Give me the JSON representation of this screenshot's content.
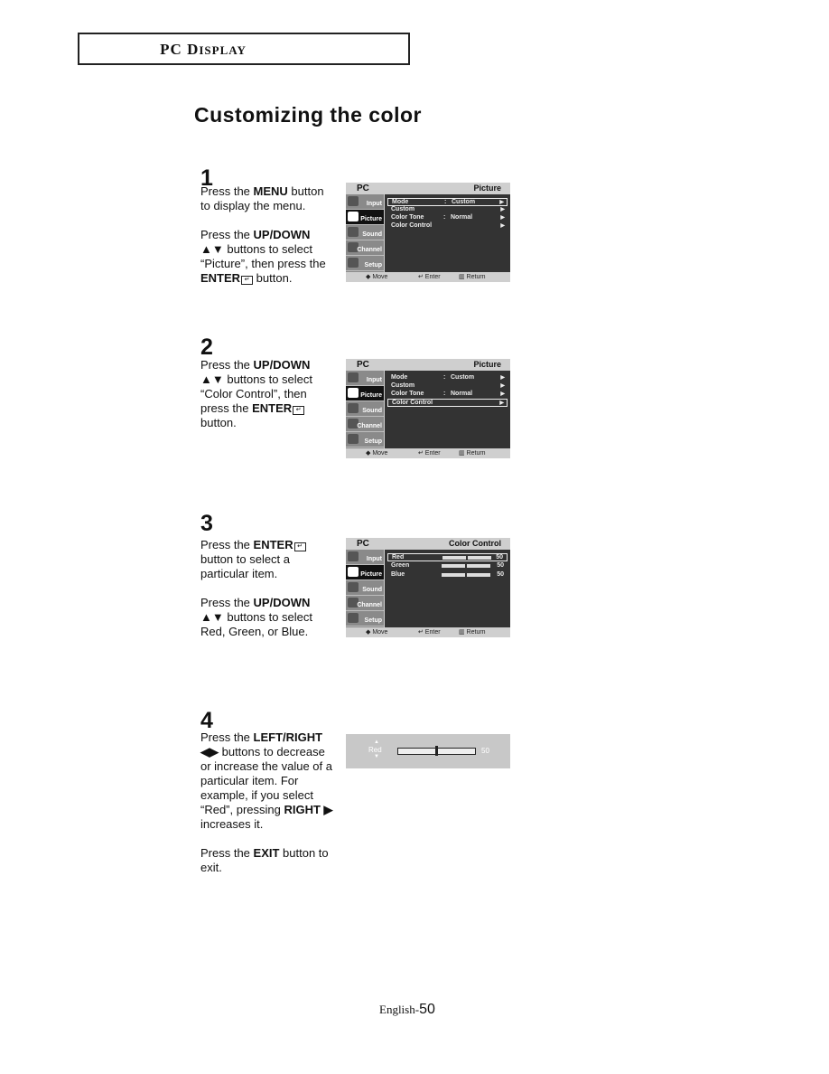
{
  "header": {
    "section_first": "PC D",
    "section_rest": "ISPLAY"
  },
  "title": "Customizing the color",
  "steps": [
    {
      "number": "1",
      "paragraphs": [
        [
          {
            "t": "Press the "
          },
          {
            "b": "MENU"
          },
          {
            "t": " button to display the menu."
          }
        ],
        [
          {
            "t": "Press the "
          },
          {
            "b": "UP/DOWN ▲▼"
          },
          {
            "t": " buttons to select “Picture”, then press the "
          },
          {
            "b": "ENTER"
          },
          {
            "icon": "enter"
          },
          {
            "t": " button."
          }
        ]
      ]
    },
    {
      "number": "2",
      "paragraphs": [
        [
          {
            "t": "Press the "
          },
          {
            "b": "UP/DOWN ▲▼"
          },
          {
            "t": " buttons to select “Color Control”, then press the "
          },
          {
            "b": "ENTER"
          },
          {
            "icon": "enter"
          },
          {
            "t": " button."
          }
        ]
      ]
    },
    {
      "number": "3",
      "paragraphs": [
        [
          {
            "t": "Press the "
          },
          {
            "b": "ENTER"
          },
          {
            "icon": "enter"
          },
          {
            "t": " button to select a particular item."
          }
        ],
        [
          {
            "t": "Press the "
          },
          {
            "b": "UP/DOWN ▲▼"
          },
          {
            "t": " buttons to select Red, Green, or Blue."
          }
        ]
      ]
    },
    {
      "number": "4",
      "paragraphs": [
        [
          {
            "t": "Press the "
          },
          {
            "b": "LEFT/RIGHT ◀▶"
          },
          {
            "t": " buttons to decrease or increase the value of a particular item. For example, if you select “Red”, pressing "
          },
          {
            "b": "RIGHT ▶"
          },
          {
            "t": " increases it."
          }
        ],
        [
          {
            "t": "Press the "
          },
          {
            "b": "EXIT"
          },
          {
            "t": " button to exit."
          }
        ]
      ]
    }
  ],
  "osd": {
    "pc_label": "PC",
    "sidebar": [
      "Input",
      "Picture",
      "Sound",
      "Channel",
      "Setup"
    ],
    "footer": {
      "move": "◆ Move",
      "enter": "Enter",
      "return": "Return"
    },
    "screens": [
      {
        "title": "Picture",
        "active_sidebar": "Picture",
        "rows": [
          {
            "label": "Mode",
            "value": "Custom",
            "arrow": "▶",
            "selected": true
          },
          {
            "label": "Custom",
            "value": "",
            "arrow": "▶",
            "selected": false
          },
          {
            "label": "Color Tone",
            "value": "Normal",
            "arrow": "▶",
            "selected": false
          },
          {
            "label": "Color Control",
            "value": "",
            "arrow": "▶",
            "selected": false
          }
        ]
      },
      {
        "title": "Picture",
        "active_sidebar": "Picture",
        "rows": [
          {
            "label": "Mode",
            "value": "Custom",
            "arrow": "▶",
            "selected": false
          },
          {
            "label": "Custom",
            "value": "",
            "arrow": "▶",
            "selected": false
          },
          {
            "label": "Color Tone",
            "value": "Normal",
            "arrow": "▶",
            "selected": false
          },
          {
            "label": "Color Control",
            "value": "",
            "arrow": "▶",
            "selected": true
          }
        ]
      },
      {
        "title": "Color Control",
        "active_sidebar": "Picture",
        "sliders": [
          {
            "label": "Red",
            "value": "50",
            "selected": true
          },
          {
            "label": "Green",
            "value": "50",
            "selected": false
          },
          {
            "label": "Blue",
            "value": "50",
            "selected": false
          }
        ]
      }
    ],
    "adjust_bar": {
      "label": "Red",
      "value": "50",
      "fraction": 0.5,
      "up": "▲",
      "down": "▼"
    }
  },
  "footer": {
    "lang": "English-",
    "page": "50"
  }
}
